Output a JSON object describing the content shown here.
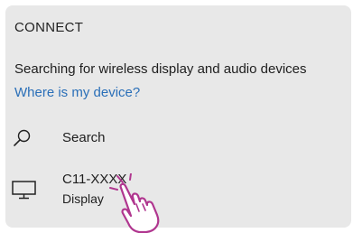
{
  "panel": {
    "heading": "CONNECT",
    "status": "Searching for wireless display and audio devices",
    "help_link": "Where is my device?"
  },
  "search": {
    "label": "Search",
    "icon": "search-icon"
  },
  "devices": [
    {
      "name": "C11-XXXX",
      "type": "Display",
      "icon": "monitor-icon"
    }
  ],
  "colors": {
    "panel_background": "#e8e8e8",
    "link": "#2a6fb8",
    "text": "#1e1e1e",
    "pointer_outline": "#b0368f"
  }
}
